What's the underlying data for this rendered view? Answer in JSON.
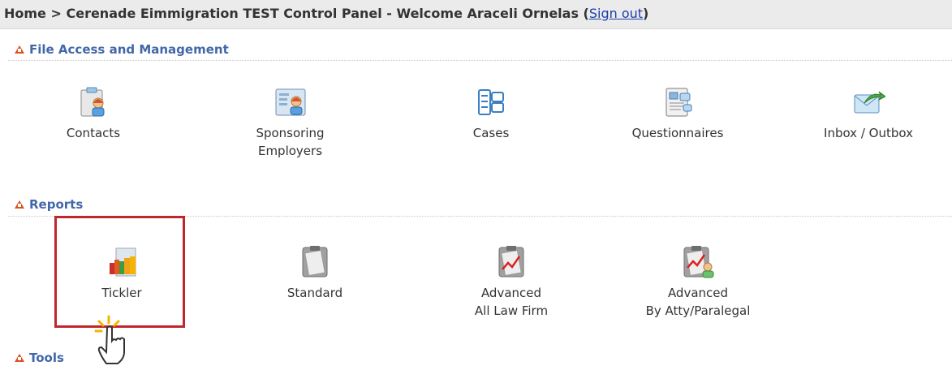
{
  "header": {
    "home": "Home",
    "sep": ">",
    "title_text": "Cerenade Eimmigration TEST Control Panel - Welcome Araceli Ornelas",
    "open_paren": "(",
    "signout_label": "Sign out",
    "close_paren": ")"
  },
  "sections": {
    "file_access": {
      "title": "File Access and Management",
      "items": [
        {
          "icon": "contacts-icon",
          "label_lines": [
            "Contacts"
          ]
        },
        {
          "icon": "sponsoring-employers-icon",
          "label_lines": [
            "Sponsoring",
            "Employers"
          ]
        },
        {
          "icon": "cases-icon",
          "label_lines": [
            "Cases"
          ]
        },
        {
          "icon": "questionnaires-icon",
          "label_lines": [
            "Questionnaires"
          ]
        },
        {
          "icon": "inbox-outbox-icon",
          "label_lines": [
            "Inbox / Outbox"
          ]
        }
      ]
    },
    "reports": {
      "title": "Reports",
      "items": [
        {
          "icon": "tickler-icon",
          "label_lines": [
            "Tickler"
          ]
        },
        {
          "icon": "standard-report-icon",
          "label_lines": [
            "Standard"
          ]
        },
        {
          "icon": "advanced-report-icon",
          "label_lines": [
            "Advanced",
            "All Law Firm"
          ]
        },
        {
          "icon": "advanced-atty-report-icon",
          "label_lines": [
            "Advanced",
            "By Atty/Paralegal"
          ]
        }
      ]
    },
    "tools": {
      "title": "Tools"
    }
  },
  "colors": {
    "section_title": "#4267a9",
    "section_triangle": "#d9531e",
    "highlight_box": "#c0272d",
    "link": "#1d3fa8"
  }
}
